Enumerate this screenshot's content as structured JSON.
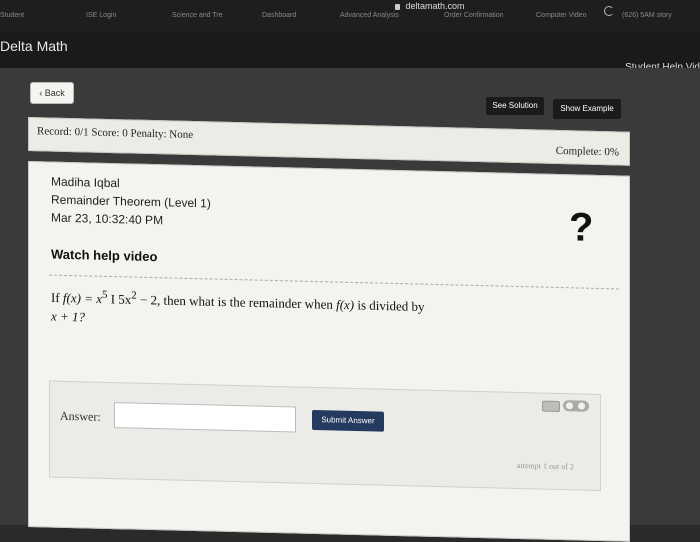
{
  "browser": {
    "url": "deltamath.com",
    "tabs": [
      "Student",
      "ISE Login",
      "Science and Tre",
      "Dashboard",
      "Advanced Analysis",
      "Order Confirmation",
      "Computer Video",
      "(626) 5AM story"
    ]
  },
  "header": {
    "logo": "Delta Math",
    "help_link": "Student Help Vid"
  },
  "toolbar": {
    "back_label": "Back",
    "see_solution_label": "See Solution",
    "show_example_label": "Show Example"
  },
  "record_bar": {
    "summary": "Record: 0/1   Score: 0   Penalty: None",
    "complete": "Complete: 0%"
  },
  "problem": {
    "student_name": "Madiha Iqbal",
    "topic": "Remainder Theorem (Level 1)",
    "timestamp": "Mar 23, 10:32:40 PM",
    "help_video": "Watch help video",
    "question_mark": "?",
    "q_prefix": "If ",
    "q_f": "f(x) = x",
    "q_exp5": "5",
    "q_op": " I 5x",
    "q_exp2": "2",
    "q_tail": " − 2, then what is the remainder when ",
    "q_fx": "f(x)",
    "q_end": " is divided by",
    "q_line2": "x + 1?"
  },
  "answer": {
    "label": "Answer:",
    "value": "",
    "submit_label": "Submit Answer",
    "attempts": "attempt 1 out of 2"
  }
}
